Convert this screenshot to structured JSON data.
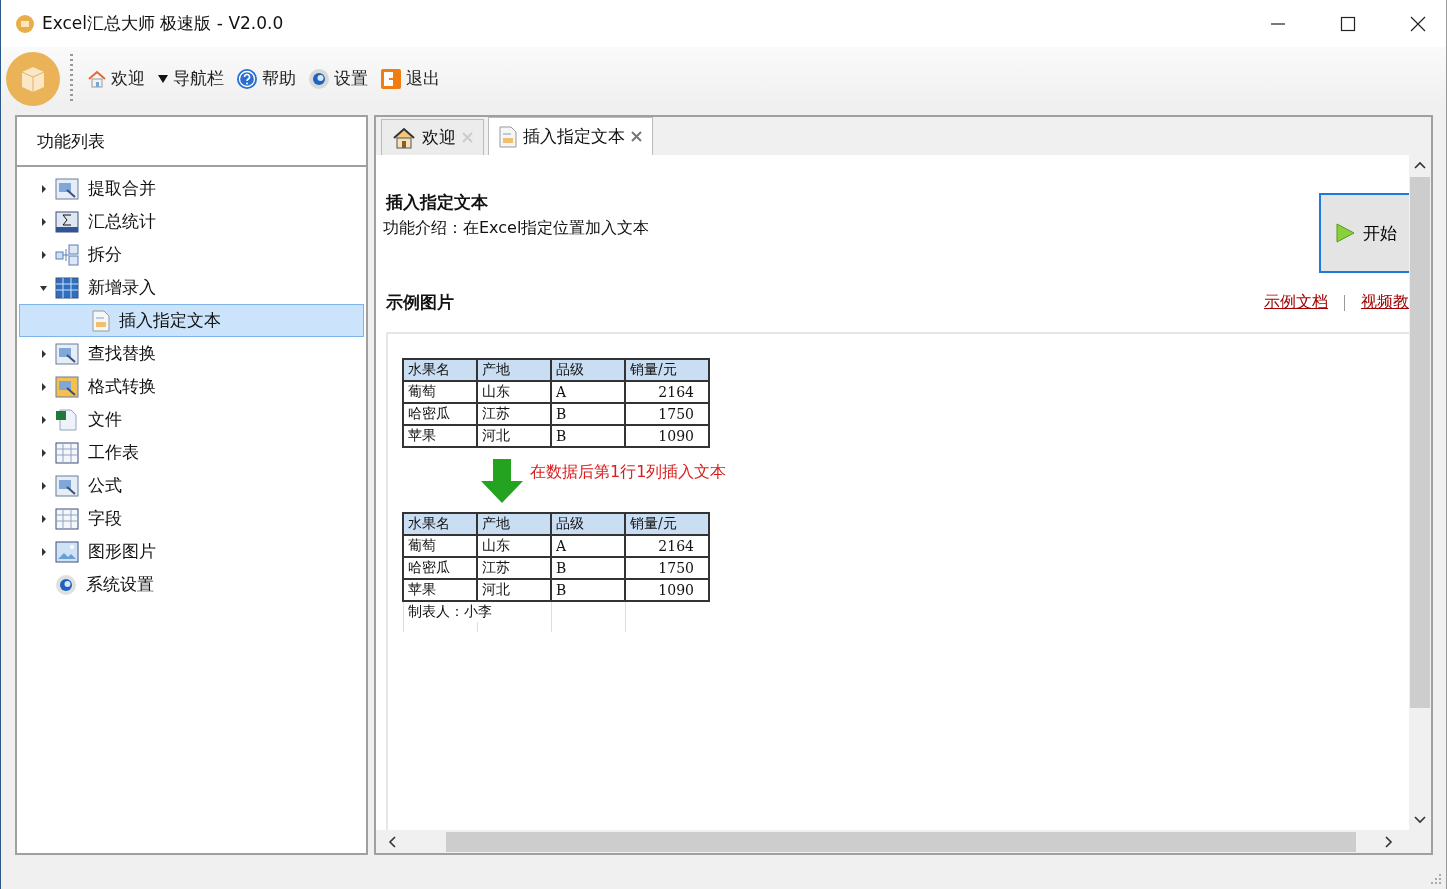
{
  "window": {
    "title": "Excel汇总大师 极速版 - V2.0.0"
  },
  "toolbar": [
    {
      "label": "欢迎"
    },
    {
      "label": "导航栏"
    },
    {
      "label": "帮助"
    },
    {
      "label": "设置"
    },
    {
      "label": "退出"
    }
  ],
  "sidebar": {
    "title": "功能列表",
    "items": [
      {
        "label": "提取合并",
        "expanded": false
      },
      {
        "label": "汇总统计",
        "expanded": false
      },
      {
        "label": "拆分",
        "expanded": false
      },
      {
        "label": "新增录入",
        "expanded": true,
        "children": [
          {
            "label": "插入指定文本",
            "selected": true
          }
        ]
      },
      {
        "label": "查找替换",
        "expanded": false
      },
      {
        "label": "格式转换",
        "expanded": false
      },
      {
        "label": "文件",
        "expanded": false
      },
      {
        "label": "工作表",
        "expanded": false
      },
      {
        "label": "公式",
        "expanded": false
      },
      {
        "label": "字段",
        "expanded": false
      },
      {
        "label": "图形图片",
        "expanded": false
      },
      {
        "label": "系统设置"
      }
    ]
  },
  "tabs": [
    {
      "label": "欢迎",
      "selected": false
    },
    {
      "label": "插入指定文本",
      "selected": true
    }
  ],
  "content": {
    "title": "插入指定文本",
    "description": "功能介绍：在Excel指定位置加入文本",
    "start_button": "开始",
    "section_title": "示例图片",
    "links": [
      "示例文档",
      "视频教"
    ],
    "example": {
      "note": "在数据后第1行1列插入文本",
      "tables": [
        {
          "columns": [
            "水果名",
            "产地",
            "品级",
            "销量/元"
          ],
          "rows": [
            [
              "葡萄",
              "山东",
              "A",
              "2164"
            ],
            [
              "哈密瓜",
              "江苏",
              "B",
              "1750"
            ],
            [
              "苹果",
              "河北",
              "B",
              "1090"
            ]
          ]
        },
        {
          "columns": [
            "水果名",
            "产地",
            "品级",
            "销量/元"
          ],
          "rows": [
            [
              "葡萄",
              "山东",
              "A",
              "2164"
            ],
            [
              "哈密瓜",
              "江苏",
              "B",
              "1750"
            ],
            [
              "苹果",
              "河北",
              "B",
              "1090"
            ]
          ],
          "footer": "制表人：小李"
        }
      ]
    }
  }
}
